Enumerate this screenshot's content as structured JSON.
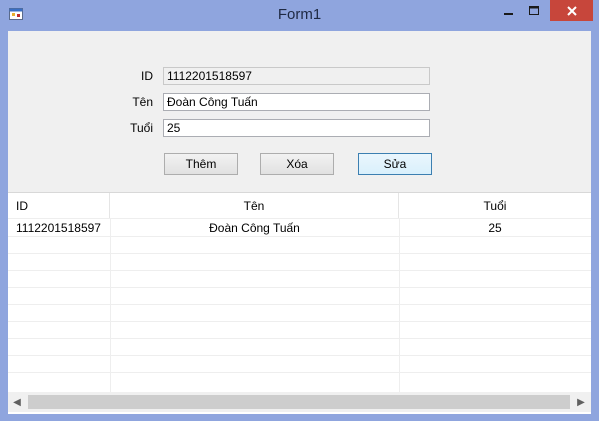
{
  "window": {
    "title": "Form1",
    "icons": {
      "app": "form-app-icon",
      "minimize": "minimize-icon",
      "maximize": "maximize-icon",
      "close": "close-icon"
    },
    "colors": {
      "titlebar": "#8fa5de",
      "close": "#c7463b",
      "client": "#f0f0f0"
    }
  },
  "form": {
    "id_label": "ID",
    "id_value": "1112201518597",
    "ten_label": "Tên",
    "ten_value": "Đoàn Công Tuấn",
    "tuoi_label": "Tuổi",
    "tuoi_value": "25"
  },
  "buttons": {
    "them": "Thêm",
    "xoa": "Xóa",
    "sua": "Sửa"
  },
  "grid": {
    "columns": [
      "ID",
      "Tên",
      "Tuổi"
    ],
    "rows": [
      [
        "1112201518597",
        "Đoàn Công Tuấn",
        "25"
      ]
    ],
    "scroll_left": "◀",
    "scroll_right": "▶"
  }
}
